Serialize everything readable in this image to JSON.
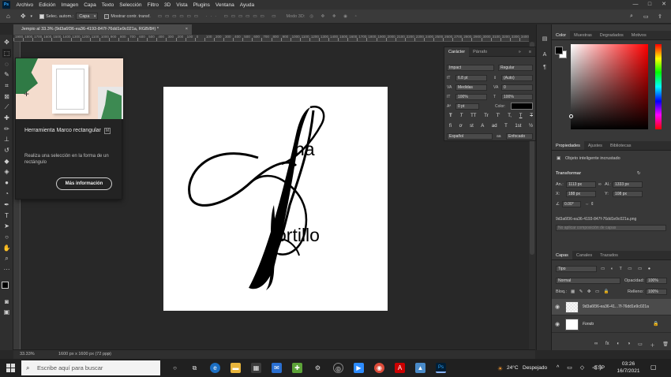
{
  "menu": {
    "app_icon": "Ps",
    "items": [
      "Archivo",
      "Edición",
      "Imagen",
      "Capa",
      "Texto",
      "Selección",
      "Filtro",
      "3D",
      "Vista",
      "Plugins",
      "Ventana",
      "Ayuda"
    ],
    "window_controls": [
      "—",
      "□",
      "✕"
    ]
  },
  "options": {
    "auto_select_label": "Selec. autom.:",
    "auto_select_value": "Capa",
    "show_transform_label": "Mostrar contr. transf.",
    "mode_3d_label": "Modo 3D:"
  },
  "document": {
    "tab_title": "Jempio al 33.3% (9d3a6f36-ea36-4193-847f-76dd1e9c021a, RGB/8#) *",
    "close": "×",
    "ruler_ticks": [
      "1900",
      "1800",
      "1700",
      "1600",
      "1500",
      "1400",
      "1300",
      "1200",
      "1100",
      "1000",
      "900",
      "800",
      "700",
      "600",
      "500",
      "400",
      "300",
      "200",
      "100",
      "0",
      "100",
      "200",
      "300",
      "400",
      "500",
      "600",
      "700",
      "800",
      "900",
      "1000",
      "1100",
      "1200",
      "1300",
      "1400",
      "1500",
      "1600",
      "1700",
      "1800",
      "1900",
      "2000",
      "2100",
      "2200",
      "2300",
      "2400",
      "2500",
      "2600",
      "2700",
      "2800",
      "2900",
      "3000",
      "3100",
      "3200",
      "3300",
      "3400"
    ],
    "artwork": {
      "text_top": "na",
      "text_bottom": "ortillo"
    }
  },
  "status": {
    "zoom": "33.33%",
    "size": "1600 px x 1600 px (72 ppp)"
  },
  "tooltip": {
    "title": "Herramienta Marco rectangular",
    "shortcut": "M",
    "description": "Realiza una selección en la forma de un rectángulo",
    "button": "Más información"
  },
  "character": {
    "tabs": [
      "Carácter",
      "Párrafo"
    ],
    "font_family": "Impact",
    "font_style": "Regular",
    "font_size": "6.8 pt",
    "leading": "(Auto)",
    "kerning": "Medidas",
    "tracking": "0",
    "vscale": "100%",
    "hscale": "100%",
    "baseline": "0 pt",
    "color_label": "Color:",
    "type_buttons": [
      "T",
      "T",
      "TT",
      "Tr",
      "T'",
      "T,",
      "T",
      "T"
    ],
    "ot_buttons": [
      "fi",
      "ơ",
      "st",
      "A",
      "ad",
      "T",
      "1st",
      "½"
    ],
    "language": "Español",
    "antialias": "Enfocado",
    "aa_glyph": "aa"
  },
  "color_panel": {
    "tabs": [
      "Color",
      "Muestras",
      "Degradados",
      "Motivos"
    ]
  },
  "properties": {
    "tabs": [
      "Propiedades",
      "Ajustes",
      "Bibliotecas"
    ],
    "object_type": "Objeto inteligente incrustado",
    "section": "Transformar",
    "w_label": "An.:",
    "w_value": "1113 px",
    "h_label": "Al.:",
    "h_value": "1333 px",
    "x_label": "X:",
    "x_value": "188 px",
    "y_label": "Y:",
    "y_value": "108 px",
    "angle": "0.00°",
    "filename": "9d3a6f36-ea36-4193-847f-76dd1e9c021a.png",
    "comp_placeholder": "No aplicar composición de capas"
  },
  "layers": {
    "tabs": [
      "Capas",
      "Canales",
      "Trazados"
    ],
    "filter": "Tipo",
    "blend": "Normal",
    "opacity_label": "Opacidad:",
    "opacity": "100%",
    "lock_label": "Bloq.:",
    "fill_label": "Relleno:",
    "fill": "100%",
    "rows": [
      {
        "name": "9d3a6f36-ea36-41...7f-76dd1e9c021a"
      },
      {
        "name": "Fondo"
      }
    ],
    "footer_icons": [
      "∞",
      "fx",
      "◐",
      "◑",
      "▭",
      "＋",
      "🗑"
    ]
  },
  "taskbar": {
    "search_placeholder": "Escribe aquí para buscar",
    "temperature": "24°C",
    "weather": "Despejado",
    "language": "ESP",
    "time": "03:26",
    "date": "16/7/2021"
  },
  "colors": {
    "bg": "#282828",
    "panel": "#383838",
    "accent": "#31a8ff"
  }
}
